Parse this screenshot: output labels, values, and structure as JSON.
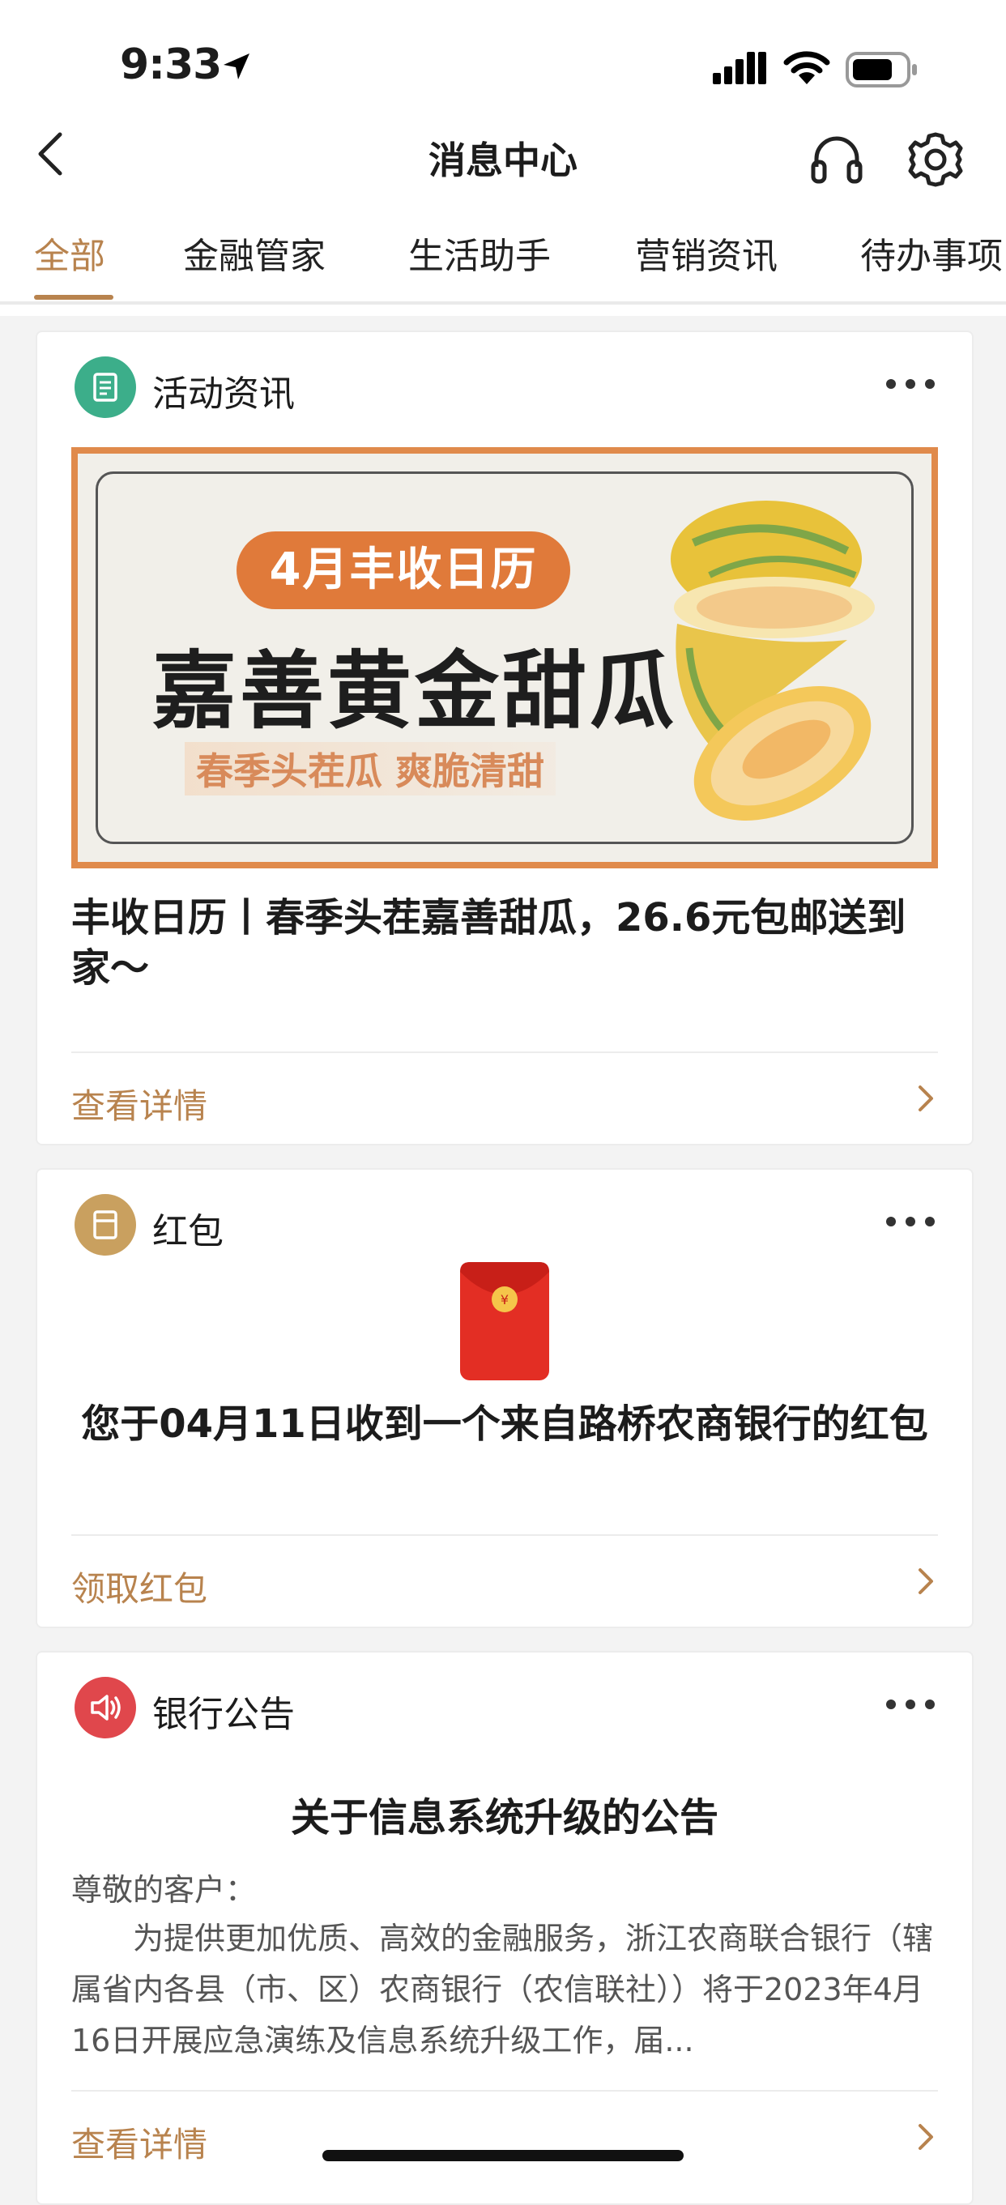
{
  "status_bar": {
    "time": "9:33"
  },
  "nav": {
    "title": "消息中心"
  },
  "tabs": [
    {
      "label": "全部",
      "active": true
    },
    {
      "label": "金融管家",
      "active": false
    },
    {
      "label": "生活助手",
      "active": false
    },
    {
      "label": "营销资讯",
      "active": false
    },
    {
      "label": "待办事项",
      "active": false
    }
  ],
  "cards": [
    {
      "category": "活动资讯",
      "icon": "document-icon",
      "icon_color": "#3cae8a",
      "banner": {
        "pill": "4月丰收日历",
        "title": "嘉善黄金甜瓜",
        "subtitle": "春季头茬瓜 爽脆清甜"
      },
      "headline": "丰收日历丨春季头茬嘉善甜瓜，26.6元包邮送到家～",
      "link": "查看详情"
    },
    {
      "category": "红包",
      "icon": "red-packet-icon",
      "icon_color": "#c9a05f",
      "message": "您于04月11日收到一个来自路桥农商银行的红包",
      "link": "领取红包"
    },
    {
      "category": "银行公告",
      "icon": "speaker-icon",
      "icon_color": "#e0474c",
      "title": "关于信息系统升级的公告",
      "greeting": "尊敬的客户：",
      "body": "为提供更加优质、高效的金融服务，浙江农商联合银行（辖属省内各县（市、区）农商银行（农信联社））将于2023年4月16日开展应急演练及信息系统升级工作，届...",
      "link": "查看详情"
    }
  ],
  "colors": {
    "accent": "#b8834e",
    "banner_border": "#e08a4b"
  }
}
